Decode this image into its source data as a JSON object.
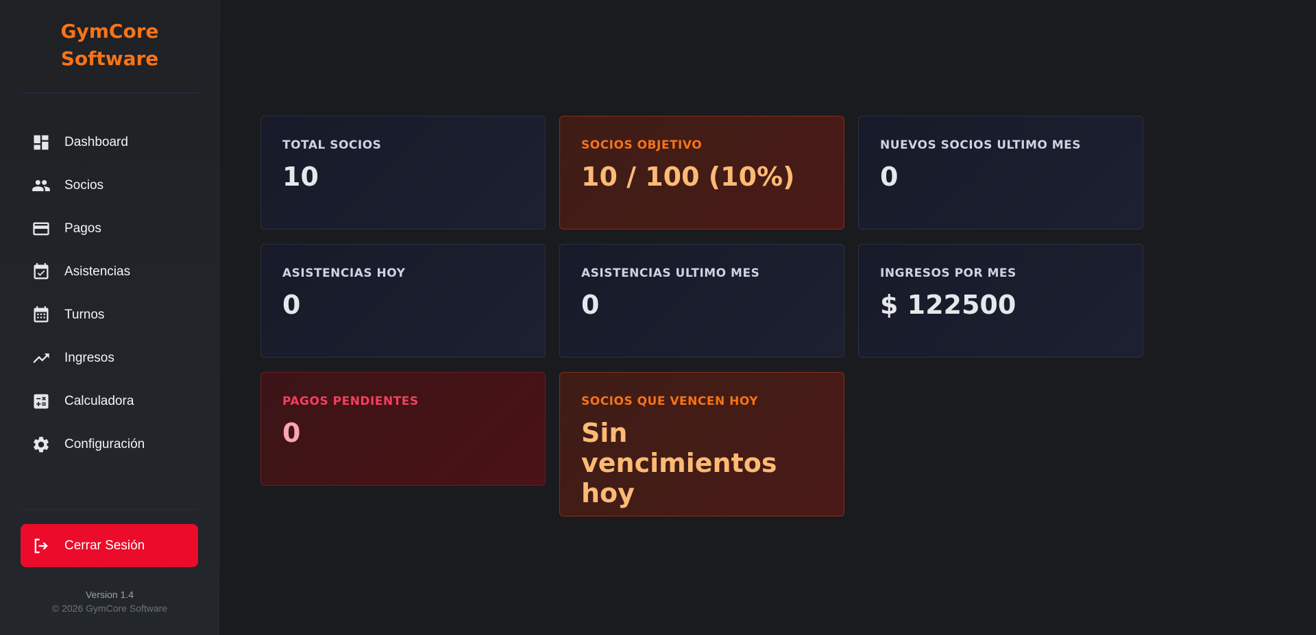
{
  "brand": {
    "line1": "GymCore",
    "line2": "Software"
  },
  "nav": {
    "items": [
      {
        "label": "Dashboard",
        "icon": "dashboard-icon"
      },
      {
        "label": "Socios",
        "icon": "people-icon"
      },
      {
        "label": "Pagos",
        "icon": "credit-card-icon"
      },
      {
        "label": "Asistencias",
        "icon": "calendar-check-icon"
      },
      {
        "label": "Turnos",
        "icon": "calendar-grid-icon"
      },
      {
        "label": "Ingresos",
        "icon": "trending-up-icon"
      },
      {
        "label": "Calculadora",
        "icon": "calculator-icon"
      },
      {
        "label": "Configuración",
        "icon": "gear-icon"
      }
    ]
  },
  "logout": {
    "label": "Cerrar Sesión",
    "icon": "logout-icon"
  },
  "footer": {
    "version": "Version 1.4",
    "copyright": "© 2026 GymCore Software"
  },
  "stats": {
    "total_socios": {
      "label": "TOTAL SOCIOS",
      "value": "10"
    },
    "socios_objetivo": {
      "label": "SOCIOS OBJETIVO",
      "value": "10 / 100 (10%)"
    },
    "nuevos_socios": {
      "label": "NUEVOS SOCIOS ULTIMO MES",
      "value": "0"
    },
    "asistencias_hoy": {
      "label": "ASISTENCIAS HOY",
      "value": "0"
    },
    "asistencias_mes": {
      "label": "ASISTENCIAS ULTIMO MES",
      "value": "0"
    },
    "ingresos_mes": {
      "label": "INGRESOS POR MES",
      "value": "$ 122500"
    },
    "pagos_pendientes": {
      "label": "PAGOS PENDIENTES",
      "value": "0"
    },
    "vencen_hoy": {
      "label": "SOCIOS QUE VENCEN HOY",
      "value": "Sin vencimientos hoy"
    }
  },
  "colors": {
    "accent": "#f97316",
    "danger": "#ec0b2a",
    "background": "#1a1b1e",
    "card": "#161a29"
  }
}
